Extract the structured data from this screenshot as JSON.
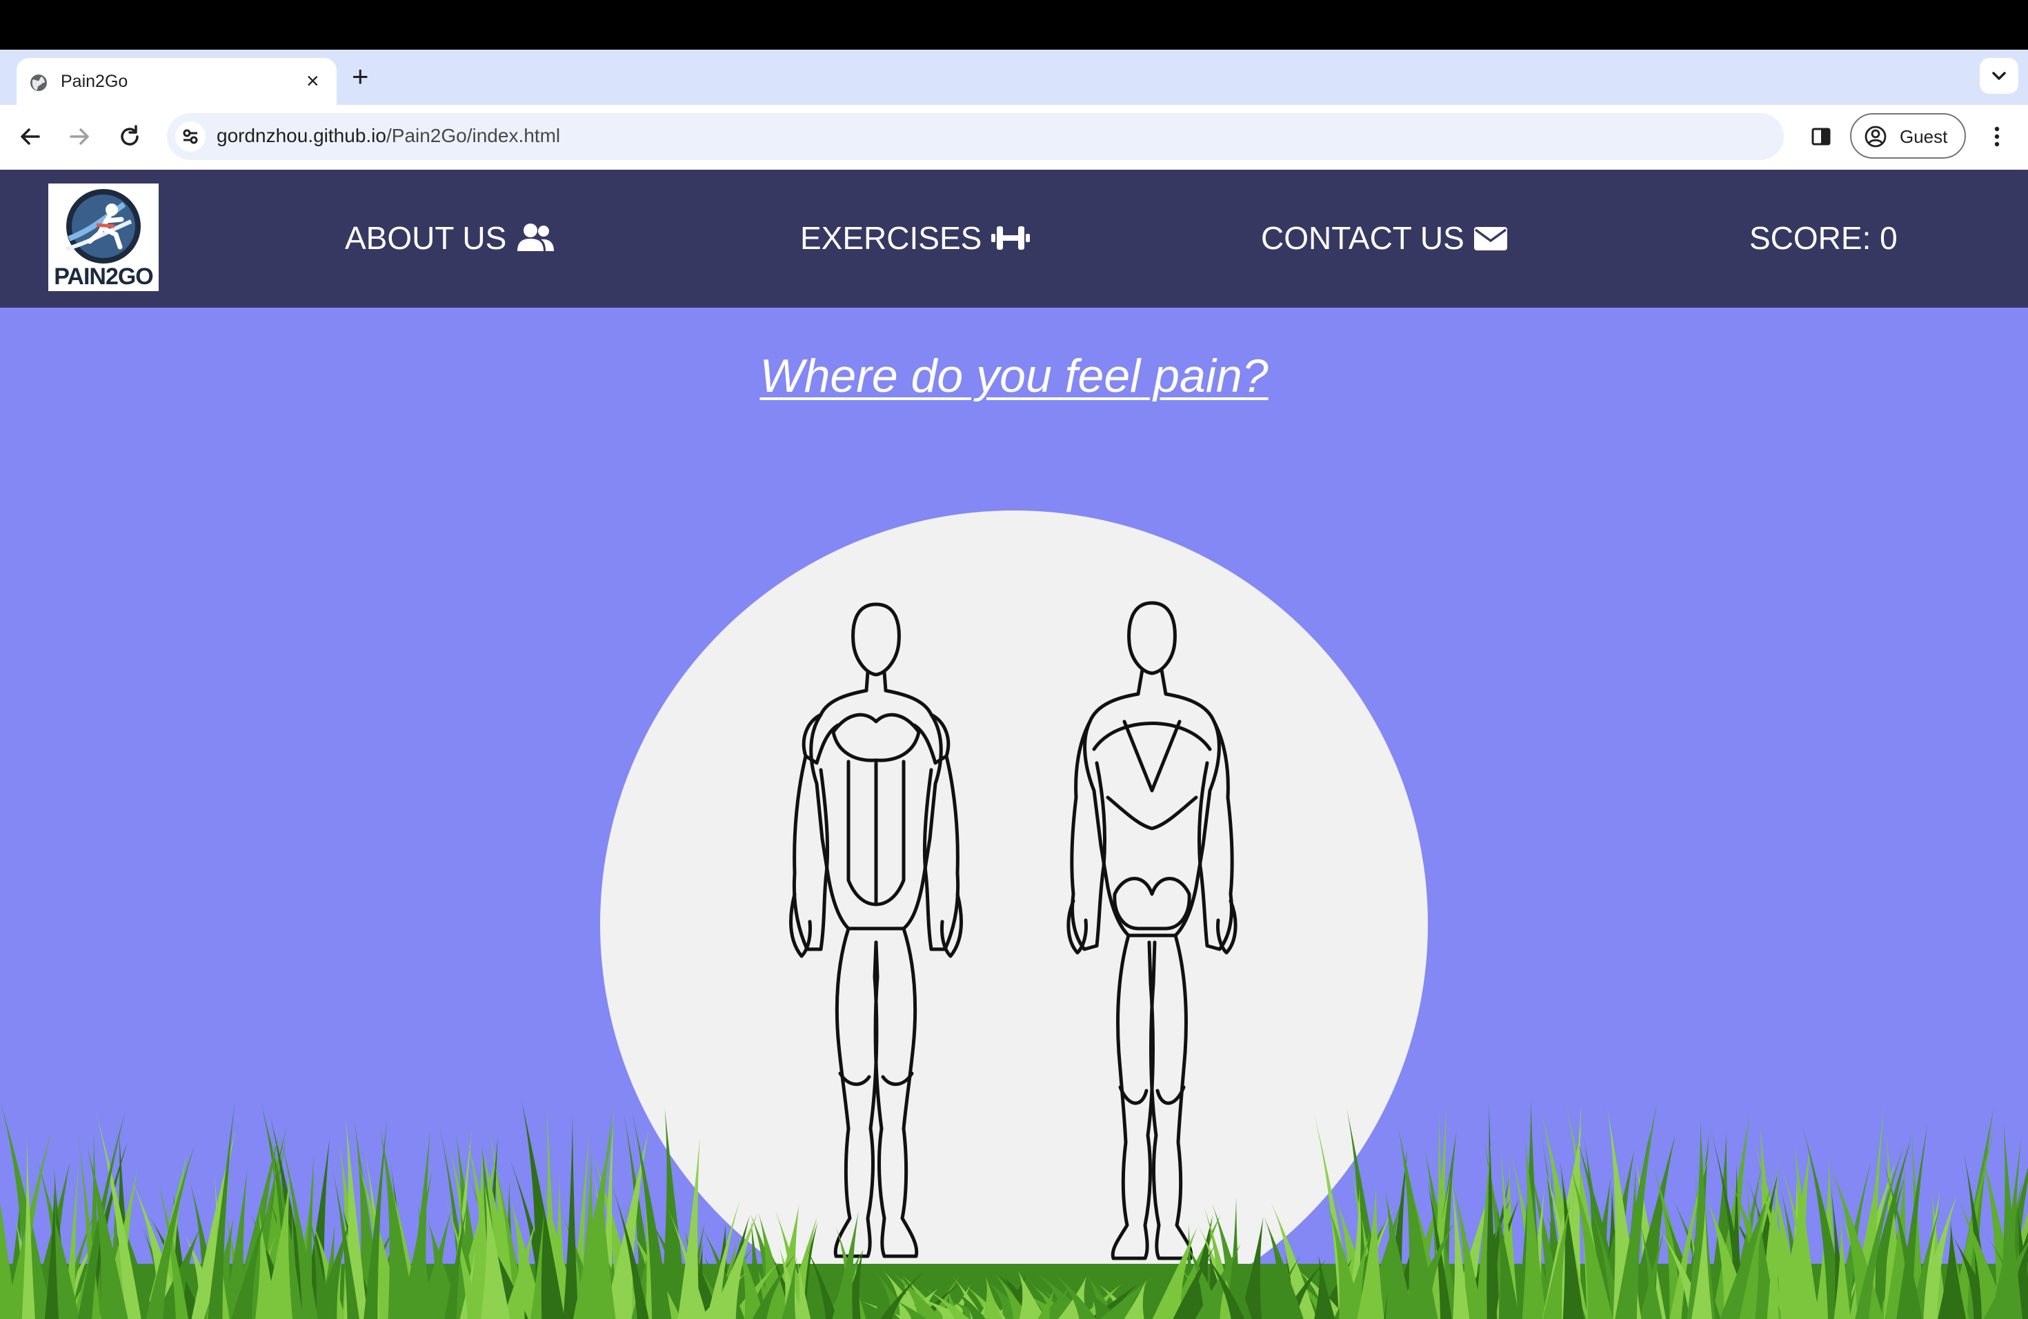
{
  "browser": {
    "tab_title": "Pain2Go",
    "new_tab_symbol": "+",
    "close_symbol": "×",
    "url_domain": "gordnzhou.github.io",
    "url_path": "/Pain2Go/index.html",
    "profile_label": "Guest"
  },
  "site": {
    "logo_text": "PAIN2GO",
    "nav": [
      {
        "label": "ABOUT US",
        "icon": "users-icon"
      },
      {
        "label": "EXERCISES",
        "icon": "dumbbell-icon"
      },
      {
        "label": "CONTACT US",
        "icon": "envelope-icon"
      }
    ],
    "score_label": "SCORE: 0",
    "heading": "Where do you feel pain?",
    "colors": {
      "nav_bg": "#373862",
      "page_bg": "#8388f4",
      "circle_bg": "#f1f1f1",
      "grass": "#5fae2c"
    }
  }
}
